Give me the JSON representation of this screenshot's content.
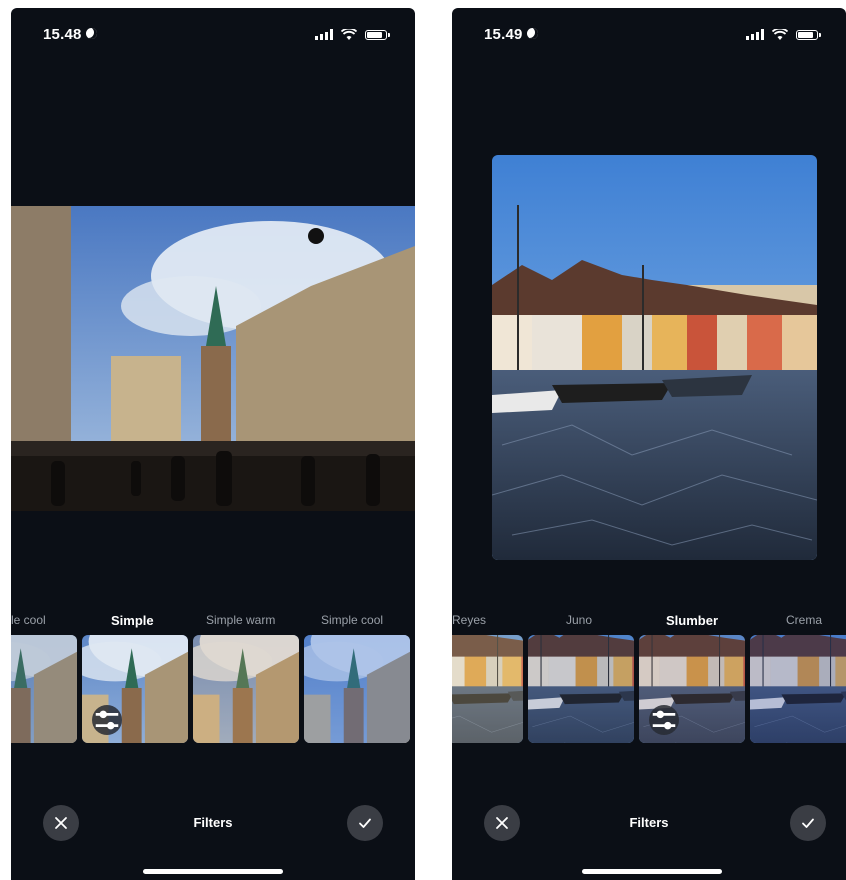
{
  "screens": [
    {
      "status": {
        "time": "15.48"
      },
      "filters": [
        {
          "label": "le cool",
          "selected": false
        },
        {
          "label": "Simple",
          "selected": true
        },
        {
          "label": "Simple warm",
          "selected": false
        },
        {
          "label": "Simple cool",
          "selected": false
        }
      ],
      "title": "Filters"
    },
    {
      "status": {
        "time": "15.49"
      },
      "filters": [
        {
          "label": "Reyes",
          "selected": false
        },
        {
          "label": "Juno",
          "selected": false
        },
        {
          "label": "Slumber",
          "selected": true
        },
        {
          "label": "Crema",
          "selected": false
        }
      ],
      "title": "Filters"
    }
  ],
  "icons": {
    "close": "close-icon",
    "confirm": "checkmark-icon",
    "adjust": "sliders-icon",
    "moon": "moon-icon",
    "signal": "cellular-signal-icon",
    "wifi": "wifi-icon",
    "battery": "battery-icon"
  },
  "colors": {
    "background": "#0b0f16",
    "button": "#3a3d44",
    "unselected_label": "#9aa0a8",
    "selected_label": "#ffffff"
  }
}
